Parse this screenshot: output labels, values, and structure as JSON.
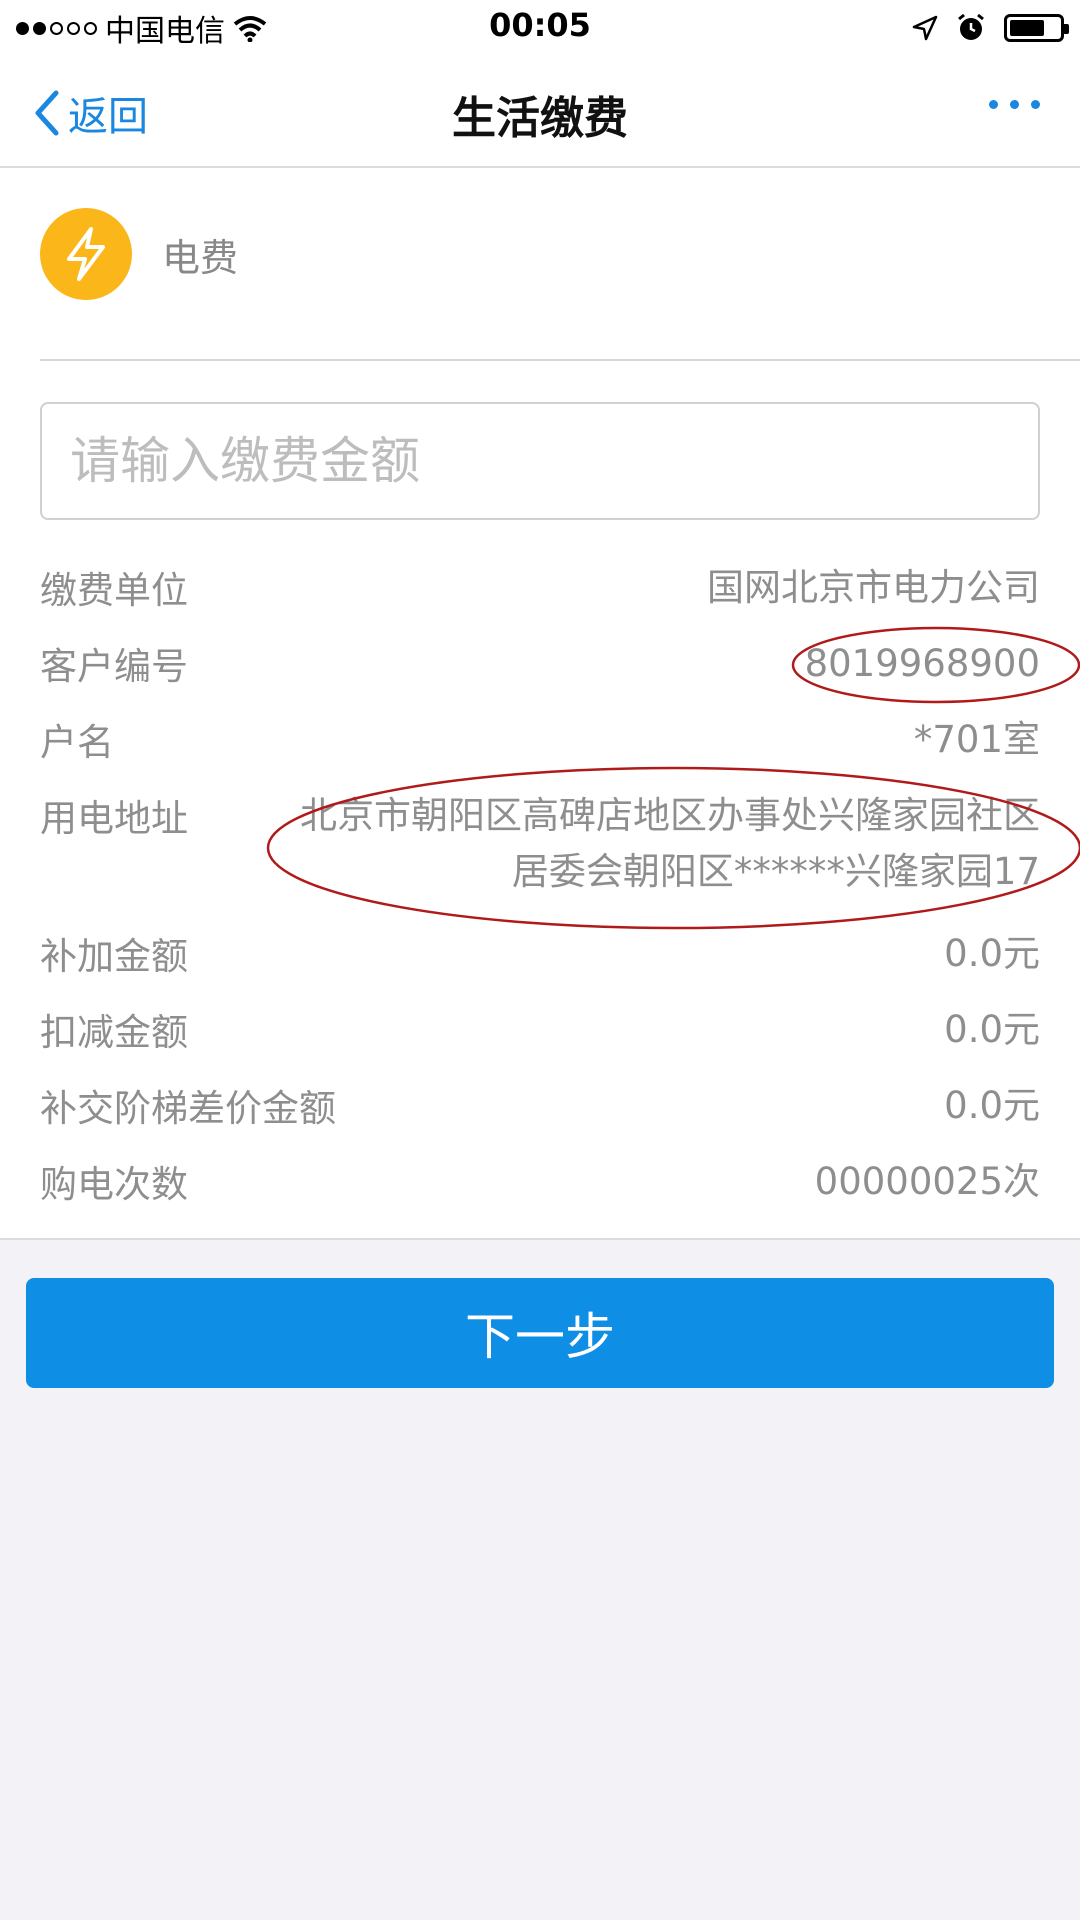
{
  "status_bar": {
    "carrier": "中国电信",
    "time": "00:05",
    "icons": [
      "signal-dots-icon",
      "wifi-icon",
      "location-arrow-icon",
      "alarm-clock-icon",
      "battery-icon"
    ]
  },
  "nav": {
    "back_label": "返回",
    "title": "生活缴费",
    "more_icon": "more-dots-icon"
  },
  "bill": {
    "icon": "lightning-icon",
    "icon_color": "#fbb61a",
    "type": "电费"
  },
  "amount": {
    "value": "",
    "placeholder": "请输入缴费金额"
  },
  "details": {
    "unit_label": "缴费单位",
    "unit_value": "国网北京市电力公司",
    "customer_label": "客户编号",
    "customer_value": "8019968900",
    "name_label": "户名",
    "name_value": "*701室",
    "address_label": "用电地址",
    "address_line1": "北京市朝阳区高碑店地区办事处兴隆家园社区",
    "address_line2": "居委会朝阳区******兴隆家园17",
    "extra_label": "补加金额",
    "extra_value": "0.0元",
    "deduct_label": "扣减金额",
    "deduct_value": "0.0元",
    "tier_label": "补交阶梯差价金额",
    "tier_value": "0.0元",
    "count_label": "购电次数",
    "count_value": "00000025次"
  },
  "action": {
    "next_label": "下一步",
    "color": "#0f8ee6"
  },
  "annotations": {
    "ellipse_color": "#b01a1a"
  }
}
